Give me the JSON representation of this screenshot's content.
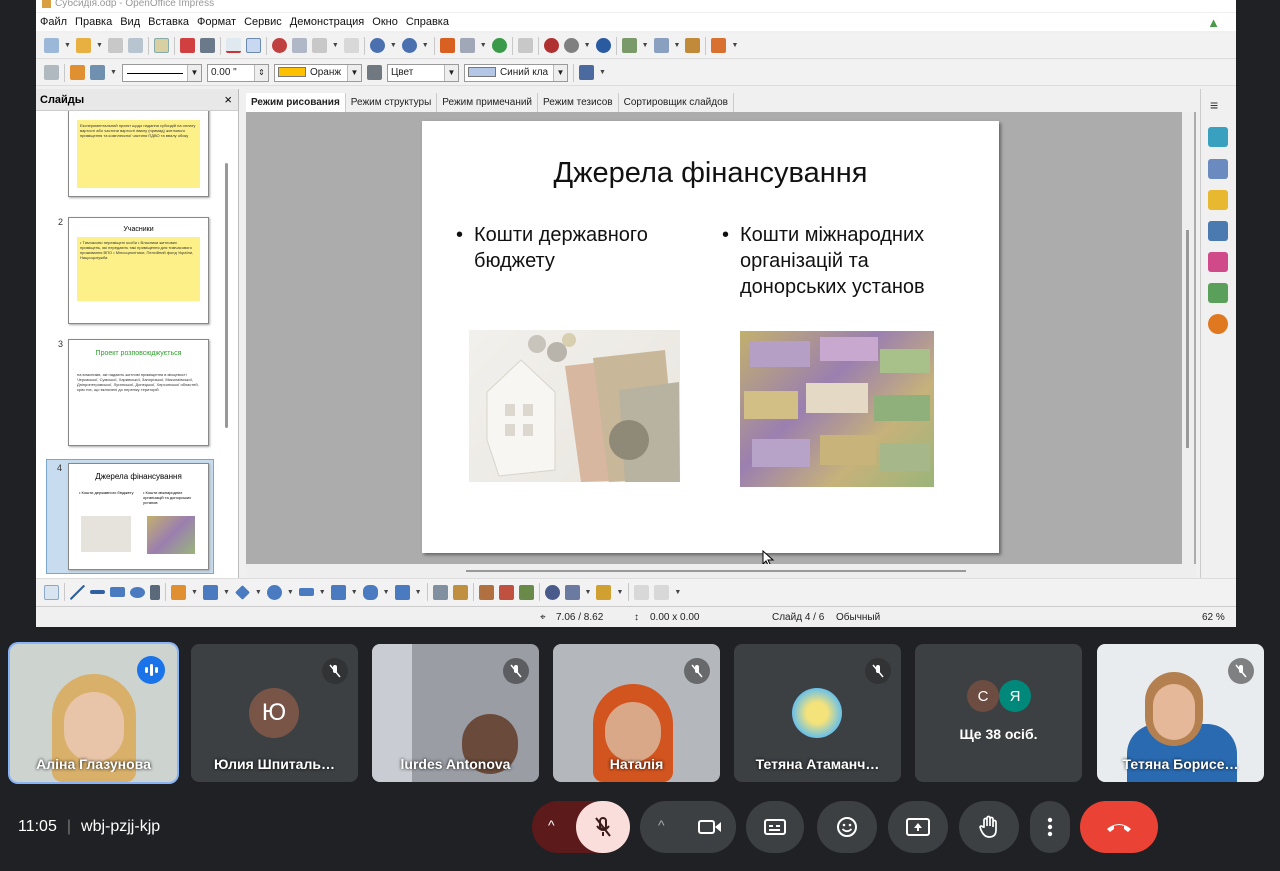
{
  "window": {
    "title": "Субсидія.odp - OpenOffice Impress"
  },
  "menu": [
    "Файл",
    "Правка",
    "Вид",
    "Вставка",
    "Формат",
    "Сервис",
    "Демонстрация",
    "Окно",
    "Справка"
  ],
  "toolbar2": {
    "line_width": "0.00 \"",
    "fill_color_label": "Оранж",
    "area_mode": "Цвет",
    "area_color_label": "Синий кла"
  },
  "slides_panel": {
    "title": "Слайды",
    "close": "×",
    "thumbs": [
      {
        "number": "",
        "title": "",
        "text": "Експериментальний проект щодо надання субсидій на оплату вартості або частини вартості ввалу (примад) житлового приміщення та комплексної частини ПДВО та ввалу обоку"
      },
      {
        "number": "2",
        "title": "Учасники",
        "text": "• Тимчасово переміщені особи • Власники житлових приміщень, які передають такі приміщення для тимчасового проживання ВПО • Мінсоцполітики, Пенсійний фонд України, Нацсоцслужба"
      },
      {
        "number": "3",
        "title": "Проект розповсюджується",
        "text": "на власників, які надають житлові приміщення в місцевості Черкаської, Сумської, Харківської, Запорізької, Миколаївської, Дніпропетровської, Луганської, Донецької, Херсонської областей, крім тих, що включені до переліку територій"
      },
      {
        "number": "4",
        "title": "Джерела фінансування",
        "left": "• Кошти державного бюджету",
        "right": "• Кошти міжнародних організацій та донорських установ"
      }
    ]
  },
  "view_tabs": [
    "Режим рисования",
    "Режим структуры",
    "Режим примечаний",
    "Режим тезисов",
    "Сортировщик слайдов"
  ],
  "slide": {
    "title": "Джерела фінансування",
    "bullet_left": "Кошти державного бюджету",
    "bullet_right": "Кошти міжнародних організацій та донорських установ"
  },
  "status": {
    "position": "7.06 / 8.62",
    "size": "0.00 x 0.00",
    "slide": "Слайд 4 / 6",
    "layout": "Обычный",
    "zoom": "62 %"
  },
  "participants": [
    {
      "name": "Аліна Глазунова",
      "speaking": true
    },
    {
      "name": "Юлия Шпиталь…",
      "initial": "Ю",
      "color": "#795548"
    },
    {
      "name": "lurdes Antonova"
    },
    {
      "name": "Наталія"
    },
    {
      "name": "Тетяна Атаманч…"
    },
    {
      "name": "Ще 38 осіб.",
      "initials": [
        "С",
        "Я"
      ]
    },
    {
      "name": "Тетяна Борисе…"
    }
  ],
  "meeting": {
    "time": "11:05",
    "code": "wbj-pzjj-kjp"
  },
  "colors": {
    "accent_blue": "#8ab4f8",
    "end_call": "#ea4335",
    "mic_off_bg": "#f9dedc"
  }
}
